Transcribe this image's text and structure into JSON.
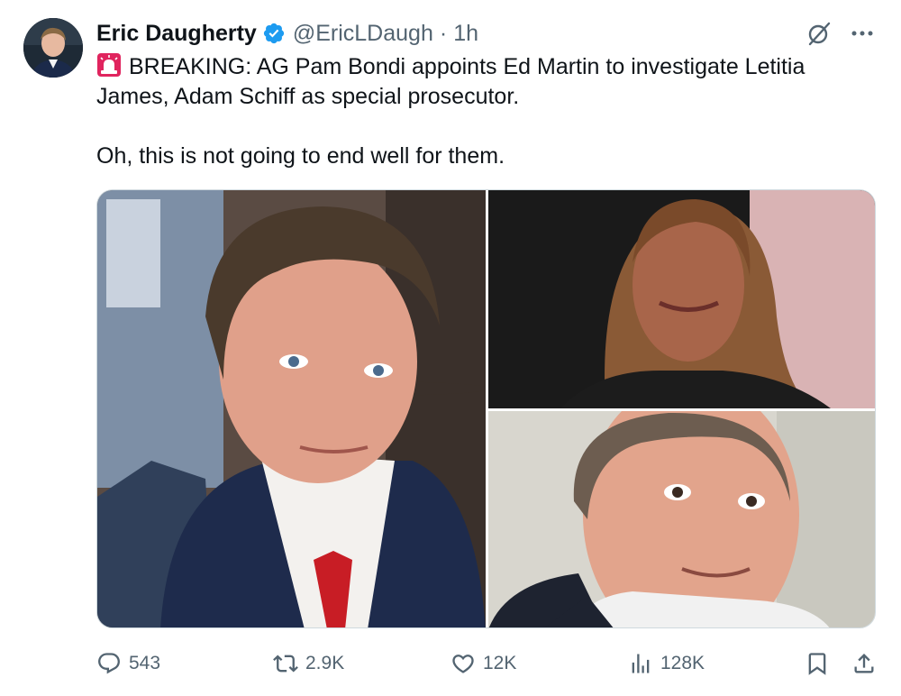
{
  "author": {
    "name": "Eric Daugherty",
    "handle": "@EricLDaugh",
    "separator": "·",
    "time": "1h"
  },
  "tweet": {
    "line1": "BREAKING: AG Pam Bondi appoints Ed Martin to investigate Letitia",
    "line2": "James, Adam Schiff as special prosecutor.",
    "line3": "Oh, this is not going to end well for them."
  },
  "stats": {
    "replies": "543",
    "reposts": "2.9K",
    "likes": "12K",
    "views": "128K"
  },
  "colors": {
    "verified": "#1d9bf0",
    "muted": "#536471",
    "siren": "#e0245e"
  },
  "icons": [
    "siren-icon",
    "verified-badge-icon",
    "grok-icon",
    "more-icon",
    "reply-icon",
    "repost-icon",
    "like-icon",
    "views-icon",
    "bookmark-icon",
    "share-icon"
  ]
}
